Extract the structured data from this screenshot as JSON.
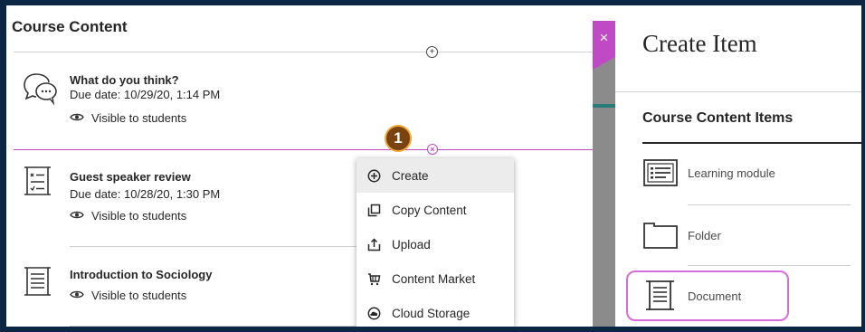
{
  "course": {
    "title": "Course Content",
    "items": [
      {
        "icon": "discussion-icon",
        "title": "What do you think?",
        "due": "Due date: 10/29/20, 1:14 PM",
        "visibility": "Visible to students"
      },
      {
        "icon": "checklist-icon",
        "title": "Guest speaker review",
        "due": "Due date: 10/28/20, 1:30 PM",
        "visibility": "Visible to students"
      },
      {
        "icon": "document-icon",
        "title": "Introduction to Sociology",
        "visibility": "Visible to students"
      }
    ]
  },
  "callout": {
    "number": "1"
  },
  "menu": {
    "items": [
      {
        "icon": "plus-circle-icon",
        "label": "Create"
      },
      {
        "icon": "copy-icon",
        "label": "Copy Content"
      },
      {
        "icon": "upload-icon",
        "label": "Upload"
      },
      {
        "icon": "cart-icon",
        "label": "Content Market"
      },
      {
        "icon": "cloud-icon",
        "label": "Cloud Storage"
      }
    ]
  },
  "panel": {
    "close_label": "×",
    "title": "Create Item",
    "section": "Course Content Items",
    "items": [
      {
        "icon": "learning-module-icon",
        "label": "Learning module"
      },
      {
        "icon": "folder-icon",
        "label": "Folder"
      },
      {
        "icon": "document-icon",
        "label": "Document"
      }
    ]
  },
  "colors": {
    "accent": "#c04ac6",
    "background": "#0b2744",
    "badge": "#7a4410",
    "badge_border": "#f2a83a"
  }
}
